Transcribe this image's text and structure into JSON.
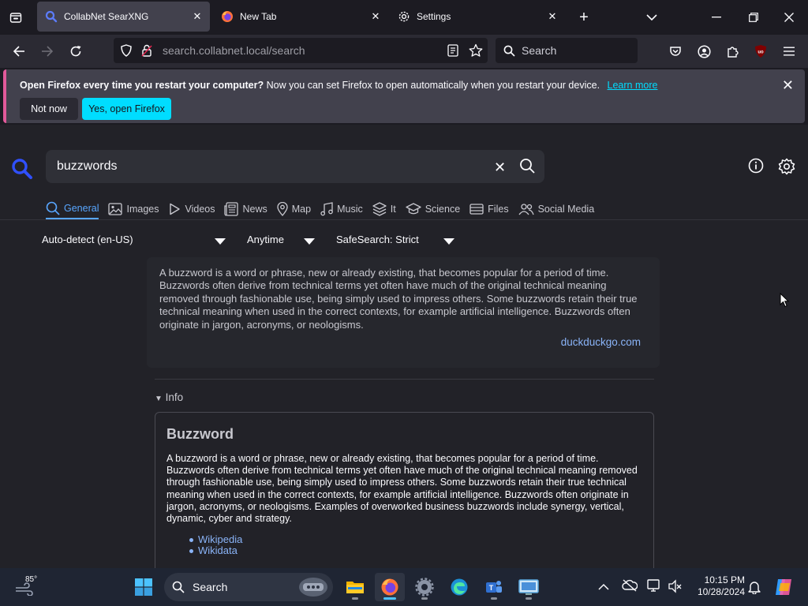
{
  "browser": {
    "tabs": [
      {
        "title": "CollabNet SearXNG",
        "active": true
      },
      {
        "title": "New Tab",
        "active": false
      },
      {
        "title": "Settings",
        "active": false
      }
    ],
    "url_host": "search.collabnet.local",
    "url_path": "/search",
    "search_placeholder": "Search"
  },
  "notification": {
    "bold": "Open Firefox every time you restart your computer?",
    "text": "Now you can set Firefox to open automatically when you restart your device.",
    "link": "Learn more",
    "not_now": "Not now",
    "yes": "Yes, open Firefox"
  },
  "searx": {
    "query": "buzzwords",
    "categories": [
      {
        "label": "General",
        "icon": "search-icon",
        "active": true
      },
      {
        "label": "Images",
        "icon": "image-icon"
      },
      {
        "label": "Videos",
        "icon": "play-icon"
      },
      {
        "label": "News",
        "icon": "newspaper-icon"
      },
      {
        "label": "Map",
        "icon": "map-pin-icon"
      },
      {
        "label": "Music",
        "icon": "music-note-icon"
      },
      {
        "label": "It",
        "icon": "layers-icon"
      },
      {
        "label": "Science",
        "icon": "graduation-cap-icon"
      },
      {
        "label": "Files",
        "icon": "drive-icon"
      },
      {
        "label": "Social Media",
        "icon": "people-icon"
      }
    ],
    "filters": {
      "language": "Auto-detect (en-US)",
      "time": "Anytime",
      "safesearch": "SafeSearch: Strict"
    },
    "answer": {
      "text": "A buzzword is a word or phrase, new or already existing, that becomes popular for a period of time. Buzzwords often derive from technical terms yet often have much of the original technical meaning removed through fashionable use, being simply used to impress others. Some buzzwords retain their true technical meaning when used in the correct contexts, for example artificial intelligence. Buzzwords often originate in jargon, acronyms, or neologisms.",
      "source": "duckduckgo.com"
    },
    "info_toggle": "Info",
    "infobox": {
      "title": "Buzzword",
      "text": "A buzzword is a word or phrase, new or already existing, that becomes popular for a period of time. Buzzwords often derive from technical terms yet often have much of the original technical meaning removed through fashionable use, being simply used to impress others. Some buzzwords retain their true technical meaning when used in the correct contexts, for example artificial intelligence. Buzzwords often originate in jargon, acronyms, or neologisms. Examples of overworked business buzzwords include synergy, vertical, dynamic, cyber and strategy.",
      "links": [
        "Wikipedia",
        "Wikidata"
      ]
    }
  },
  "taskbar": {
    "weather": "85°",
    "search": "Search",
    "time": "10:15 PM",
    "date": "10/28/2024"
  },
  "colors": {
    "accent": "#00ddff",
    "link": "#8ab4f8",
    "active_category": "#58a6ff"
  }
}
